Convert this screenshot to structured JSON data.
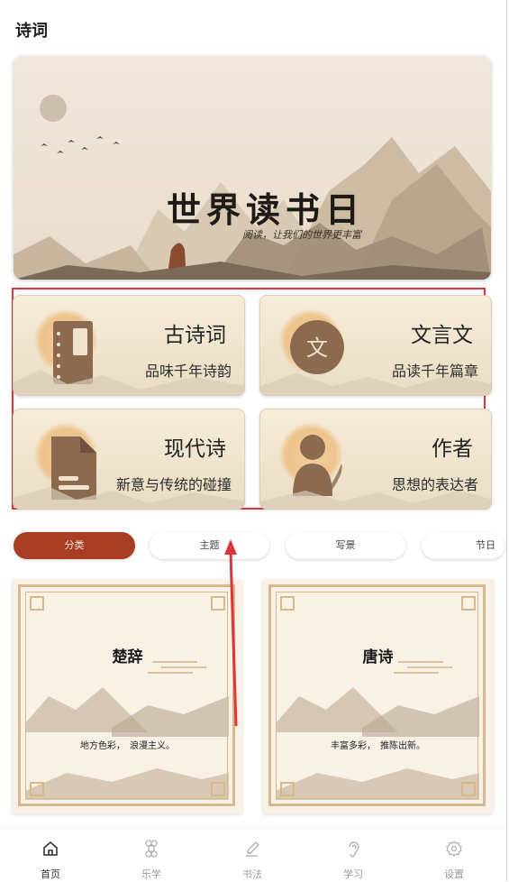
{
  "header": {
    "title": "诗词"
  },
  "banner": {
    "title": "世界读书日",
    "subtitle": "阅读，让我们的世界更丰富"
  },
  "categories": [
    {
      "name": "古诗词",
      "desc": "品味千年诗韵",
      "icon": "scroll-book-icon"
    },
    {
      "name": "文言文",
      "desc": "品读千年篇章",
      "icon": "wen-character-icon",
      "glyph": "文"
    },
    {
      "name": "现代诗",
      "desc": "新意与传统的碰撞",
      "icon": "document-icon"
    },
    {
      "name": "作者",
      "desc": "思想的表达者",
      "icon": "author-quill-icon"
    }
  ],
  "tabs": [
    {
      "label": "分类",
      "active": true
    },
    {
      "label": "主题",
      "active": false
    },
    {
      "label": "写景",
      "active": false
    },
    {
      "label": "节日",
      "active": false
    }
  ],
  "poems": [
    {
      "name": "楚辞",
      "desc": "地方色彩，　浪漫主义。"
    },
    {
      "name": "唐诗",
      "desc": "丰富多彩，　推陈出新。"
    }
  ],
  "nav": [
    {
      "label": "首页",
      "icon": "home-icon",
      "active": true
    },
    {
      "label": "乐学",
      "icon": "command-icon",
      "active": false
    },
    {
      "label": "书法",
      "icon": "brush-icon",
      "active": false
    },
    {
      "label": "学习",
      "icon": "ear-icon",
      "active": false
    },
    {
      "label": "设置",
      "icon": "gear-icon",
      "active": false
    }
  ],
  "colors": {
    "accent": "#a83e24",
    "highlight_box": "#e0343c",
    "arrow": "#e0343c"
  }
}
